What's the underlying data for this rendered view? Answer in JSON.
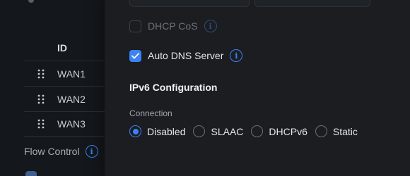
{
  "background": {
    "table": {
      "header": "ID",
      "rows": [
        {
          "id": "WAN1"
        },
        {
          "id": "WAN2"
        },
        {
          "id": "WAN3"
        }
      ]
    },
    "flow_control_label": "Flow Control"
  },
  "modal": {
    "dhcp_cos": {
      "label": "DHCP CoS",
      "checked": false,
      "enabled": false
    },
    "auto_dns": {
      "label": "Auto DNS Server",
      "checked": true
    },
    "ipv6_section_title": "IPv6 Configuration",
    "connection": {
      "label": "Connection",
      "selected": "Disabled",
      "options": [
        {
          "label": "Disabled",
          "selected": true
        },
        {
          "label": "SLAAC",
          "selected": false
        },
        {
          "label": "DHCPv6",
          "selected": false
        },
        {
          "label": "Static",
          "selected": false
        }
      ]
    }
  },
  "icons": {
    "info": "info-icon",
    "drag": "drag-handle-icon",
    "check": "check-icon"
  },
  "colors": {
    "accent": "#3b82f6",
    "modal_bg": "#1b1d21",
    "page_bg": "#14171b"
  }
}
